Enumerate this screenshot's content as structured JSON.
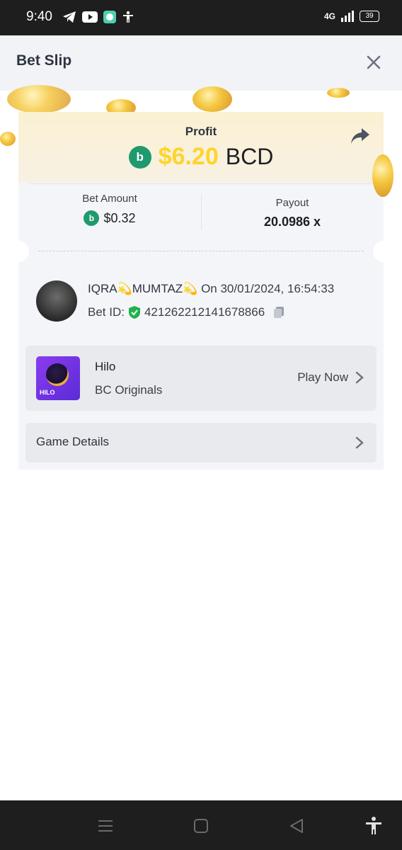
{
  "status_bar": {
    "time": "9:40",
    "network": "4G",
    "battery": "39"
  },
  "header": {
    "title": "Bet Slip"
  },
  "profit": {
    "label": "Profit",
    "amount": "$6.20",
    "currency": "BCD",
    "coin_letter": "b"
  },
  "bet": {
    "amount_label": "Bet Amount",
    "amount_value": "$0.32",
    "payout_label": "Payout",
    "payout_value": "20.0986 x"
  },
  "user": {
    "name": "IQRA💫MUMTAZ💫",
    "date_text": "On 30/01/2024, 16:54:33",
    "bet_id_label": "Bet ID:",
    "bet_id": "421262212141678866"
  },
  "game": {
    "name": "Hilo",
    "provider": "BC Originals",
    "thumb_text": "HILO",
    "play_label": "Play Now"
  },
  "details": {
    "label": "Game Details"
  },
  "colors": {
    "accent_gold": "#ffd42a",
    "bc_green": "#1f9a6e",
    "shield_green": "#22b14c"
  }
}
